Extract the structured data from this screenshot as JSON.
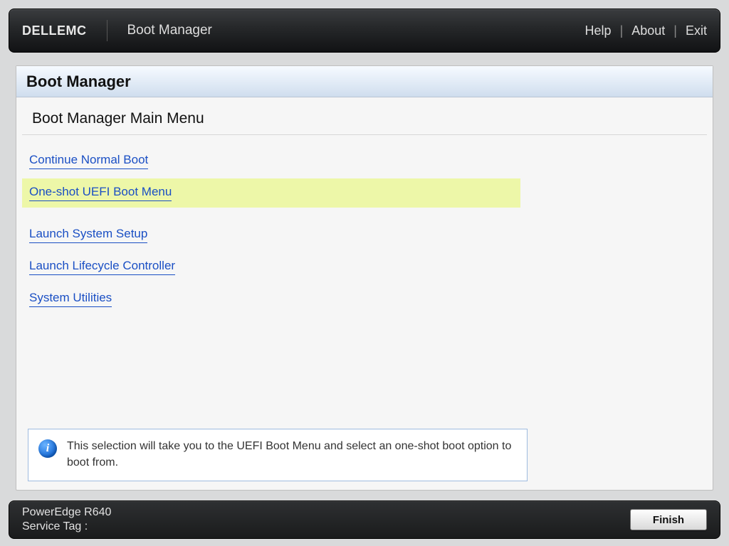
{
  "header": {
    "brand": "DELLEMC",
    "title": "Boot Manager",
    "links": {
      "help": "Help",
      "about": "About",
      "exit": "Exit"
    }
  },
  "panel": {
    "title": "Boot Manager",
    "subtitle": "Boot Manager Main Menu"
  },
  "menu": {
    "items": [
      {
        "label": "Continue Normal Boot",
        "selected": false
      },
      {
        "label": "One-shot UEFI Boot Menu",
        "selected": true
      },
      {
        "label": "Launch System Setup",
        "selected": false
      },
      {
        "label": "Launch Lifecycle Controller",
        "selected": false
      },
      {
        "label": "System Utilities",
        "selected": false
      }
    ]
  },
  "info": {
    "text": "This selection will take you to the UEFI Boot Menu and select an one-shot boot option to boot from."
  },
  "footer": {
    "model": "PowerEdge R640",
    "service_tag_label": "Service Tag :",
    "finish": "Finish"
  }
}
